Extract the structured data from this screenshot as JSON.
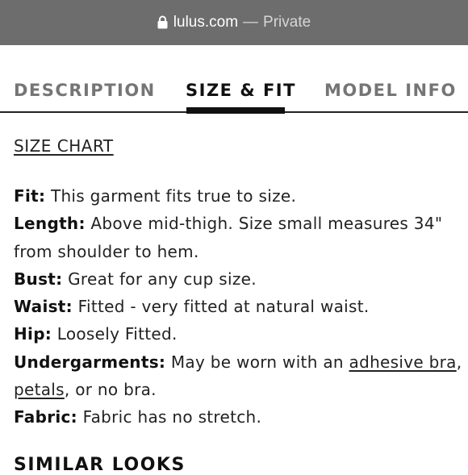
{
  "browser": {
    "domain": "lulus.com",
    "separator": "—",
    "mode": "Private"
  },
  "tabs": [
    {
      "label": "DESCRIPTION",
      "active": false
    },
    {
      "label": "SIZE & FIT",
      "active": true
    },
    {
      "label": "MODEL INFO",
      "active": false
    }
  ],
  "size_chart_link": "SIZE CHART",
  "details": {
    "fit": {
      "label": "Fit:",
      "text": " This garment fits true to size."
    },
    "length": {
      "label": "Length:",
      "text": " Above mid-thigh. Size small measures 34\" from shoulder to hem."
    },
    "bust": {
      "label": "Bust:",
      "text": " Great for any cup size."
    },
    "waist": {
      "label": "Waist:",
      "text": " Fitted - very fitted at natural waist."
    },
    "hip": {
      "label": "Hip:",
      "text": " Loosely Fitted."
    },
    "undergarments": {
      "label": "Undergarments:",
      "text_before": " May be worn with an ",
      "link1": "adhesive bra",
      "middle": ", ",
      "link2": "petals",
      "text_after": ", or no bra."
    },
    "fabric": {
      "label": "Fabric:",
      "text": " Fabric has no stretch."
    }
  },
  "similar_heading": "SIMILAR LOOKS",
  "colors": {
    "url_bar_bg": "#6d6d6d",
    "active_tab": "#111111",
    "inactive_tab": "#757575"
  }
}
